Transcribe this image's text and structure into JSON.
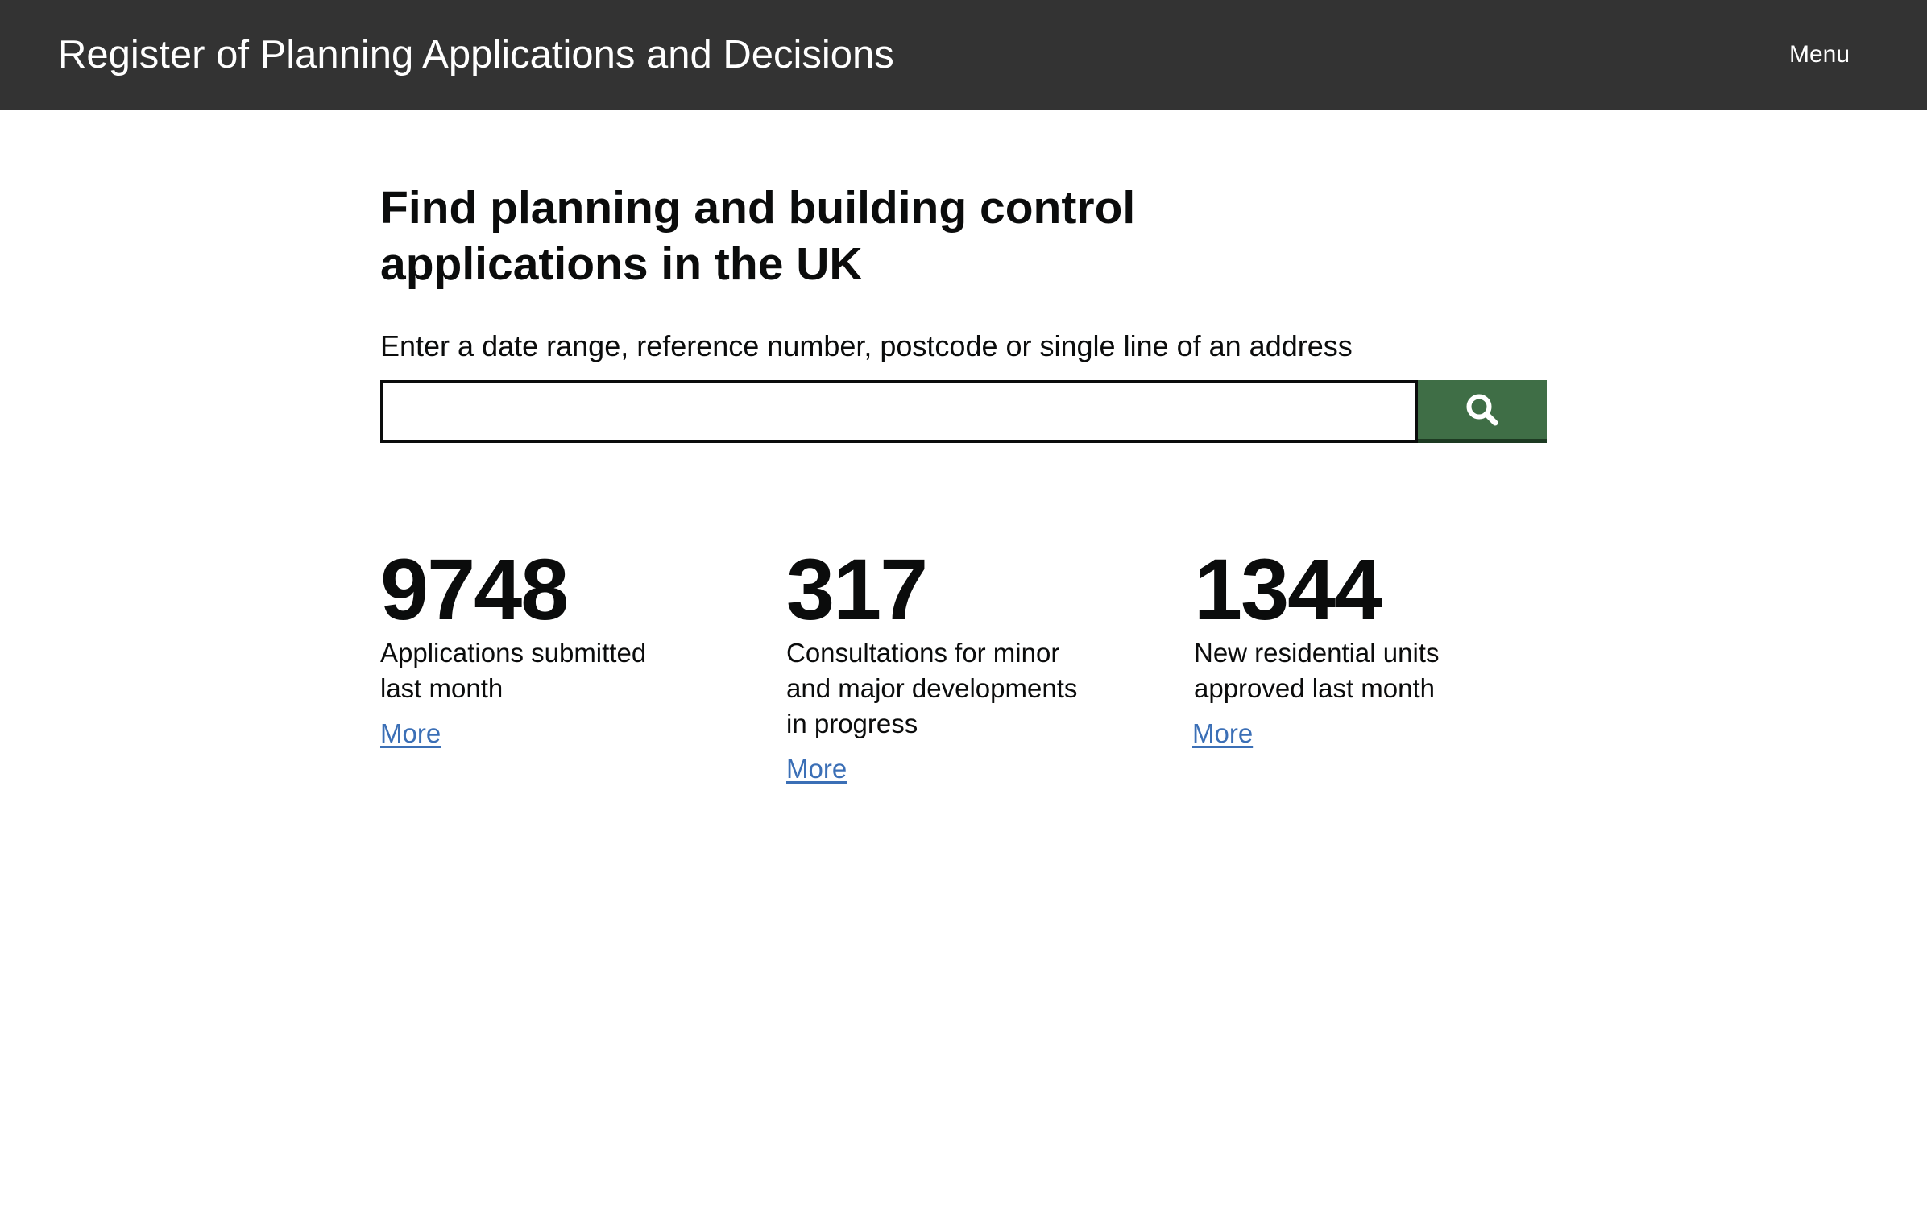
{
  "header": {
    "title": "Register of Planning Applications and Decisions",
    "menu_label": "Menu"
  },
  "main": {
    "title": "Find planning and building control applications in the UK",
    "search": {
      "label": "Enter a date range, reference number, postcode or single line of an address",
      "value": "",
      "placeholder": "",
      "button_icon": "search-icon"
    },
    "stats": [
      {
        "number": "9748",
        "label": "Applications submitted last month",
        "link": "More"
      },
      {
        "number": "317",
        "label": "Consultations for minor and major developments in progress",
        "link": "More"
      },
      {
        "number": "1344",
        "label": "New residential units approved last month",
        "link": "More"
      }
    ]
  },
  "colors": {
    "header_bg": "#333333",
    "button_bg": "#3f6e46",
    "link": "#3b6fb6"
  }
}
